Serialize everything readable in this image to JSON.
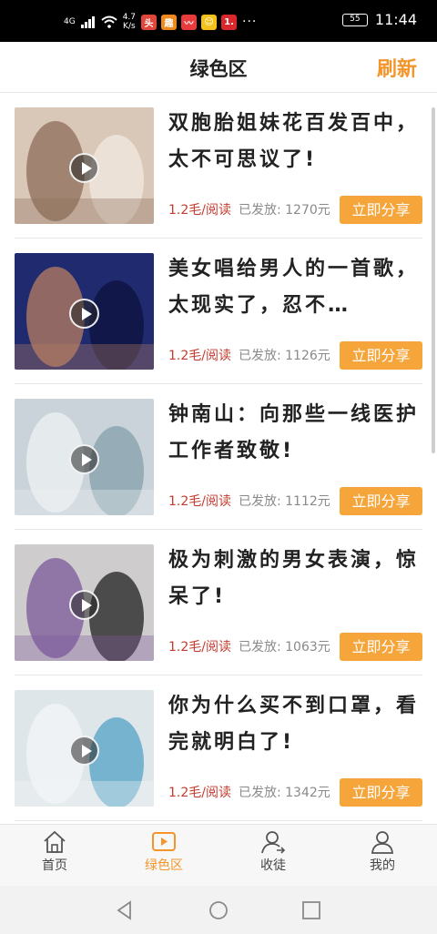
{
  "status_bar": {
    "signal": "4G",
    "speed_value": "4.7",
    "speed_unit": "K/s",
    "apps": [
      {
        "icon": "app-icon-red",
        "glyph": "头",
        "color": "#e2463a"
      },
      {
        "icon": "app-icon-orange",
        "glyph": "趣",
        "color": "#f08a1e"
      },
      {
        "icon": "app-icon-chart",
        "glyph": "〰",
        "color": "#e83b3b"
      },
      {
        "icon": "app-icon-yellow",
        "glyph": "☺",
        "color": "#f4c21b"
      },
      {
        "icon": "app-icon-red-1",
        "glyph": "1.",
        "color": "#d8282c"
      }
    ],
    "more": "···",
    "battery": "55",
    "time": "11:44"
  },
  "header": {
    "title": "绿色区",
    "refresh_label": "刷新"
  },
  "items": [
    {
      "title": "双胞胎姐妹花百发百中，太不可思议了!",
      "reward": "1.2毛/阅读",
      "sent": "已发放: 1270元",
      "share_label": "立即分享",
      "thumb_colors": [
        "#d9c7b8",
        "#8c6d5a",
        "#efe7df"
      ]
    },
    {
      "title": "美女唱给男人的一首歌，太现实了，忍不…",
      "reward": "1.2毛/阅读",
      "sent": "已发放: 1126元",
      "share_label": "立即分享",
      "thumb_colors": [
        "#202a6e",
        "#b77d62",
        "#0e1440"
      ]
    },
    {
      "title": "钟南山：向那些一线医护工作者致敬!",
      "reward": "1.2毛/阅读",
      "sent": "已发放: 1112元",
      "share_label": "立即分享",
      "thumb_colors": [
        "#c9d3d9",
        "#eef1f3",
        "#8aa2ad"
      ]
    },
    {
      "title": "极为刺激的男女表演，惊呆了!",
      "reward": "1.2毛/阅读",
      "sent": "已发放: 1063元",
      "share_label": "立即分享",
      "thumb_colors": [
        "#cfcccd",
        "#7a5a9a",
        "#2b2b2b"
      ]
    },
    {
      "title": "你为什么买不到口罩，看完就明白了!",
      "reward": "1.2毛/阅读",
      "sent": "已发放: 1342元",
      "share_label": "立即分享",
      "thumb_colors": [
        "#dfe6ea",
        "#f4f6f7",
        "#5aa6c8"
      ]
    }
  ],
  "tabs": [
    {
      "label": "首页",
      "icon": "home-icon",
      "active": false
    },
    {
      "label": "绿色区",
      "icon": "video-icon",
      "active": true
    },
    {
      "label": "收徒",
      "icon": "recruit-icon",
      "active": false
    },
    {
      "label": "我的",
      "icon": "profile-icon",
      "active": false
    }
  ],
  "colors": {
    "accent": "#f4952a",
    "share_button": "#f5a53a",
    "reward_text": "#c43a2e"
  }
}
